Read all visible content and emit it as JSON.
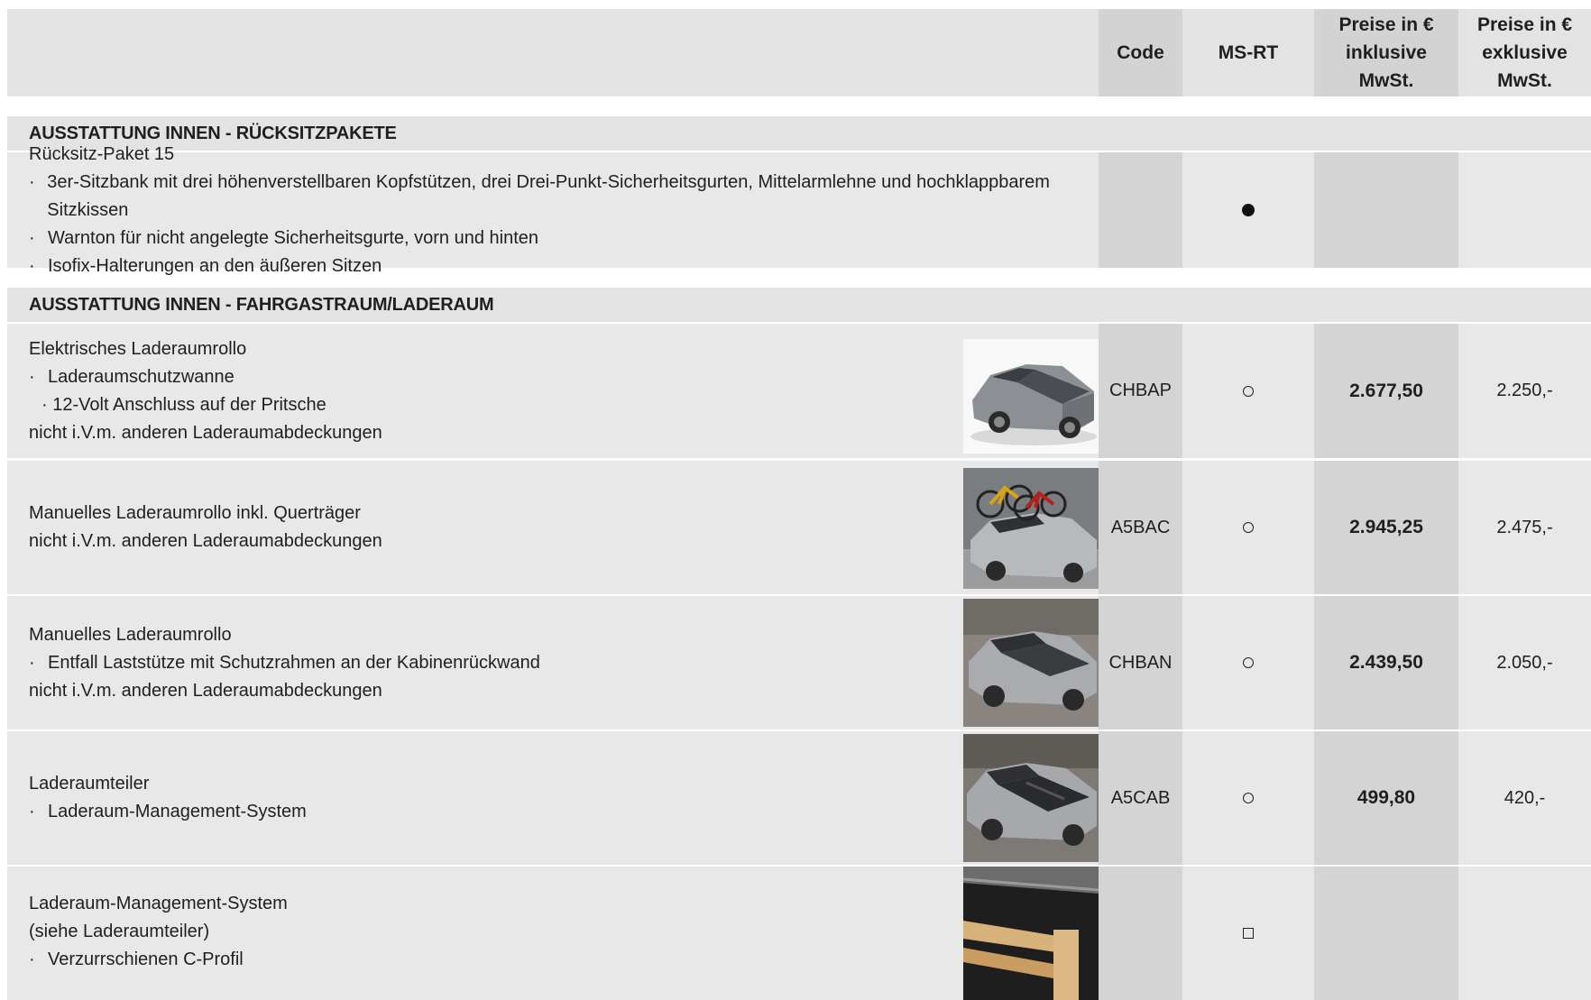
{
  "header": {
    "code": "Code",
    "ms_rt": "MS-RT",
    "price_incl_1": "Preise in €",
    "price_incl_2": "inklusive",
    "price_incl_3": "MwSt.",
    "price_excl_1": "Preise in €",
    "price_excl_2": "exklusive",
    "price_excl_3": "MwSt."
  },
  "sections": [
    {
      "title": "AUSSTATTUNG INNEN - RÜCKSITZPAKETE"
    },
    {
      "title": "AUSSTATTUNG INNEN - FAHRGASTRAUM/LADERAUM"
    }
  ],
  "rows": [
    {
      "title": "Rücksitz-Paket 15",
      "bullets": [
        "3er-Sitzbank mit drei höhenverstellbaren Kopfstützen, drei Drei-Punkt-Sicherheitsgurten, Mittelarmlehne und hochklappbarem Sitzkissen",
        "Warnton für nicht angelegte Sicherheitsgurte, vorn und hinten",
        "Isofix-Halterungen an den äußeren Sitzen"
      ],
      "code": "",
      "ms_rt_mark": "standard",
      "price_incl": "",
      "price_excl": ""
    },
    {
      "title": "Elektrisches Laderaumrollo",
      "bullets": [
        "Laderaumschutzwanne"
      ],
      "sub_bullet": "12-Volt Anschluss auf der Pritsche",
      "note": "nicht i.V.m. anderen Laderaumabdeckungen",
      "code": "CHBAP",
      "ms_rt_mark": "optional",
      "price_incl": "2.677,50",
      "price_excl": "2.250,-",
      "image": "pickup-electric-cover-photo"
    },
    {
      "title": "Manuelles Laderaumrollo inkl. Querträger",
      "note": "nicht i.V.m. anderen Laderaumabdeckungen",
      "code": "A5BAC",
      "ms_rt_mark": "optional",
      "price_incl": "2.945,25",
      "price_excl": "2.475,-",
      "image": "pickup-bikes-crossbar-photo"
    },
    {
      "title": "Manuelles Laderaumrollo",
      "bullets": [
        "Entfall Laststütze mit Schutzrahmen an der Kabinenrückwand"
      ],
      "note": "nicht i.V.m. anderen Laderaumabdeckungen",
      "code": "CHBAN",
      "ms_rt_mark": "optional",
      "price_incl": "2.439,50",
      "price_excl": "2.050,-",
      "image": "pickup-manual-cover-photo"
    },
    {
      "title": "Laderaumteiler",
      "bullets": [
        "Laderaum-Management-System"
      ],
      "code": "A5CAB",
      "ms_rt_mark": "optional",
      "price_incl": "499,80",
      "price_excl": "420,-",
      "image": "pickup-divider-photo"
    },
    {
      "title": "Laderaum-Management-System",
      "title2": "(siehe Laderaumteiler)",
      "bullets": [
        "Verzurrschienen C-Profil"
      ],
      "code": "",
      "ms_rt_mark": "package",
      "price_incl": "",
      "price_excl": "",
      "image": "cargo-rails-wood-photo"
    }
  ],
  "bullet_char": "·"
}
